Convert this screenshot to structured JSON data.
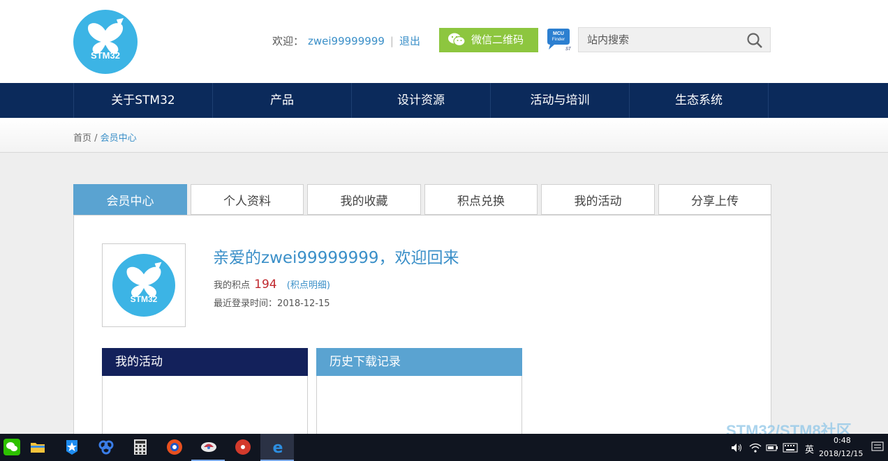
{
  "header": {
    "logo_text": "STM32",
    "welcome_label": "欢迎：",
    "username": "zwei99999999",
    "separator": "|",
    "logout": "退出",
    "wechat_button": "微信二维码",
    "mcu_finder_label": "MCU Finder",
    "search_placeholder": "站内搜索"
  },
  "nav": {
    "items": [
      {
        "label": "关于STM32"
      },
      {
        "label": "产品"
      },
      {
        "label": "设计资源"
      },
      {
        "label": "活动与培训"
      },
      {
        "label": "生态系统"
      }
    ]
  },
  "breadcrumb": {
    "home": "首页",
    "separator": " / ",
    "current": "会员中心"
  },
  "tabs": [
    {
      "label": "会员中心",
      "active": true
    },
    {
      "label": "个人资料",
      "active": false
    },
    {
      "label": "我的收藏",
      "active": false
    },
    {
      "label": "积点兑换",
      "active": false
    },
    {
      "label": "我的活动",
      "active": false
    },
    {
      "label": "分享上传",
      "active": false
    }
  ],
  "profile": {
    "avatar_text": "STM32",
    "greeting": "亲爱的zwei99999999，欢迎回来",
    "points_label": "我的积点",
    "points_value": "194",
    "points_detail": "(积点明细)",
    "last_login": "最近登录时间：2018-12-15"
  },
  "boxes": [
    {
      "title": "我的活动",
      "color": "#13215b"
    },
    {
      "title": "历史下载记录",
      "color": "#5aa3d1"
    }
  ],
  "taskbar": {
    "icons": [
      "wechat-icon",
      "file-explorer-icon",
      "app-star-icon",
      "baidu-netdisk-icon",
      "calculator-icon",
      "browser-icon",
      "app-icon",
      "security-icon",
      "edge-icon"
    ],
    "ime": "英",
    "time": "0:48",
    "date": "2018/12/15"
  },
  "watermark": "STM32/STM8社区"
}
